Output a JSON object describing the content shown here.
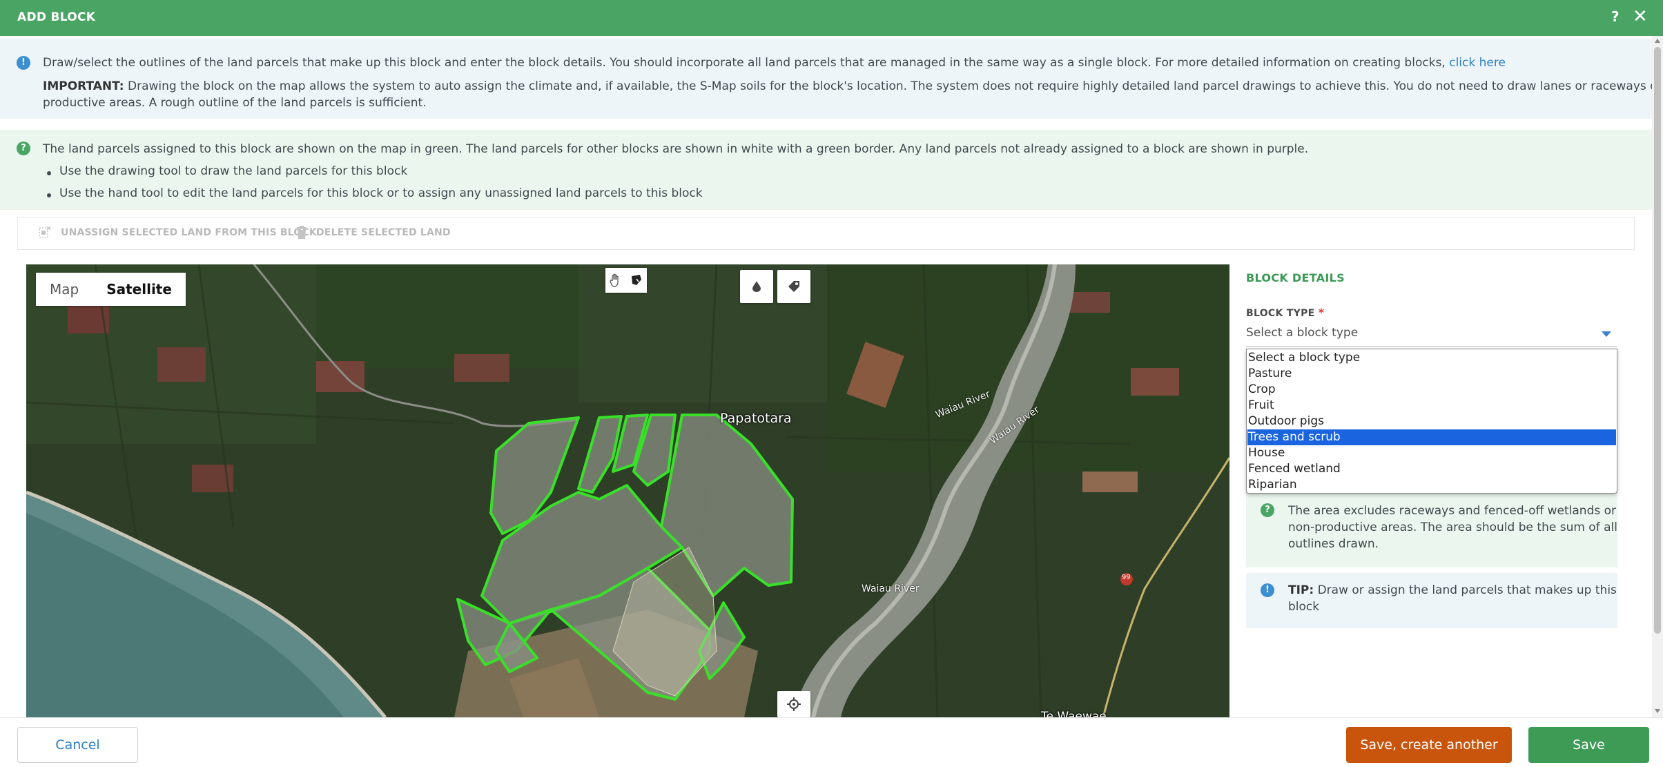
{
  "dialog": {
    "title": "ADD BLOCK",
    "help_label": "?",
    "close_label": "✕"
  },
  "info_primary": {
    "text": "Draw/select the outlines of the land parcels that make up this block and enter the block details. You should incorporate all land parcels that are managed in the same way as a single block. For more detailed information on creating blocks,",
    "link": "click here",
    "important_label": "IMPORTANT:",
    "important_line1": "Drawing the block on the map allows the system to auto assign the climate and, if available, the S-Map soils for the block's location. The system does not require highly detailed land parcel drawings to achieve this. You do not need to draw lanes or raceways or other non-",
    "important_line2": "productive areas. A rough outline of the land parcels is sufficient."
  },
  "info_secondary": {
    "text": "The land parcels assigned to this block are shown on the map in green. The land parcels for other blocks are shown in white with a green border. Any land parcels not already assigned to a block are shown in purple.",
    "bullets": [
      "Use the drawing tool to draw the land parcels for this block",
      "Use the hand tool to edit the land parcels for this block or to assign any unassigned land parcels to this block"
    ]
  },
  "toolbar": {
    "unassign_label": "UNASSIGN SELECTED LAND FROM THIS BLOCK",
    "delete_label": "DELETE SELECTED LAND"
  },
  "map": {
    "type_options": [
      "Map",
      "Satellite"
    ],
    "selected_type": "Satellite",
    "labels": {
      "town": "Papatotara",
      "river1": "Waiau River",
      "river2": "Waiau River",
      "river3": "Waiau River",
      "road_badge": "99",
      "town2": "Te Waewae"
    },
    "colors": {
      "own_block_outline": "#39e02a",
      "selected_block_fill": "#8a8f84"
    }
  },
  "block_details": {
    "title": "BLOCK DETAILS",
    "block_type_label": "BLOCK TYPE",
    "required_marker": "*",
    "select_placeholder": "Select a block type",
    "options": [
      "Select a block type",
      "Pasture",
      "Crop",
      "Fruit",
      "Outdoor pigs",
      "Trees and scrub",
      "House",
      "Fenced wetland",
      "Riparian"
    ],
    "highlighted_option": "Trees and scrub",
    "area_help_line1": "The area excludes raceways and fenced-off wetlands or",
    "area_help_line2": "non-productive areas. The area should be the sum of all",
    "area_help_line3": "outlines drawn.",
    "tip_label": "TIP:",
    "tip_line1": "Draw or assign the land parcels that makes up this",
    "tip_line2": "block"
  },
  "footer": {
    "cancel_label": "Cancel",
    "save_another_label": "Save, create another",
    "save_label": "Save"
  },
  "colors": {
    "header_green": "#4aa564",
    "save_green": "#3e9b56",
    "save_another_orange": "#c9550c",
    "link_blue": "#2a7fc9",
    "dropdown_highlight": "#1a64e0"
  }
}
